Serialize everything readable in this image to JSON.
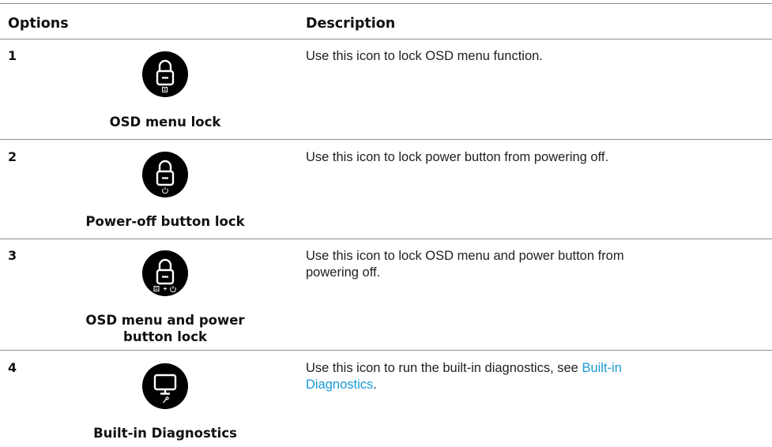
{
  "table": {
    "header": {
      "options": "Options",
      "description": "Description"
    },
    "rows": [
      {
        "number": "1",
        "icon": "lock-osd-menu-icon",
        "caption": "OSD menu lock",
        "description": "Use this icon to lock OSD menu function."
      },
      {
        "number": "2",
        "icon": "lock-power-button-icon",
        "caption": "Power-off button lock",
        "description": "Use this icon to lock power button from powering off."
      },
      {
        "number": "3",
        "icon": "lock-osd-and-power-icon",
        "caption_line1": "OSD menu and power",
        "caption_line2": "button lock",
        "description_line1": "Use this icon to lock OSD menu and power button from",
        "description_line2": "powering off."
      },
      {
        "number": "4",
        "icon": "monitor-diagnostics-icon",
        "caption": "Built-in Diagnostics",
        "description_prefix": "Use this icon to run the built-in diagnostics, see ",
        "link_line1": "Built-in",
        "link_line2": "Diagnostics",
        "description_suffix": "."
      }
    ]
  },
  "colors": {
    "icon_bg": "#000000",
    "icon_fg": "#ffffff",
    "link": "#1a9ad6",
    "rule": "#8e8e8e"
  }
}
